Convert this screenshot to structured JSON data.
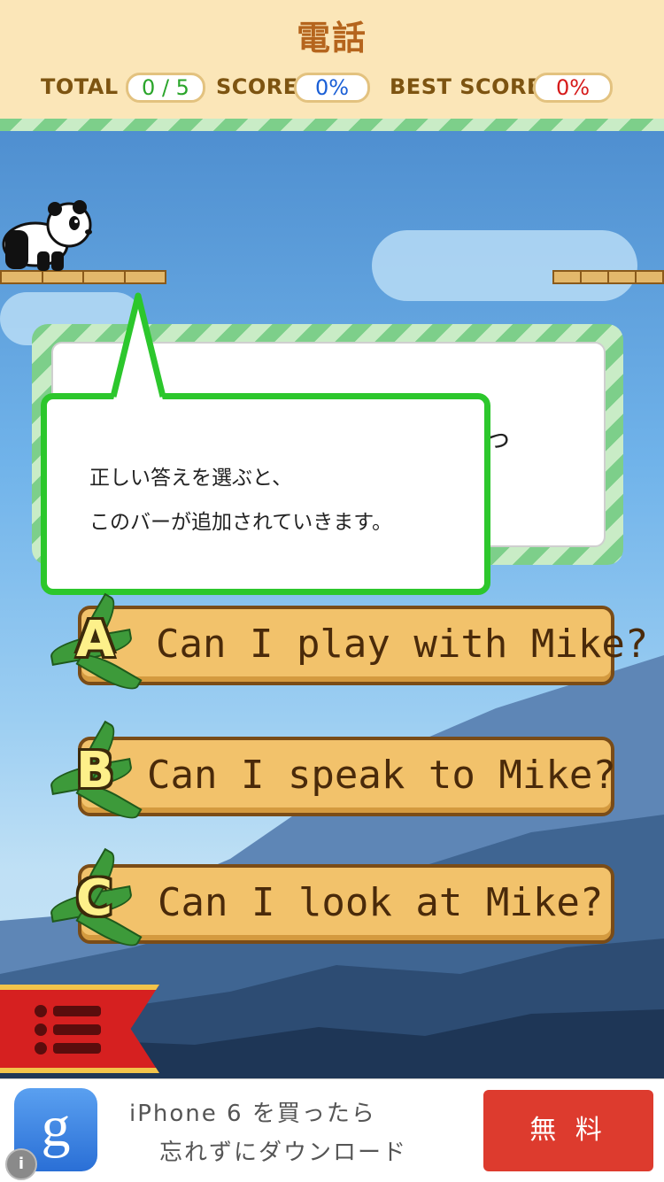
{
  "header": {
    "title": "電話",
    "total_label": "TOTAL",
    "total_value": "0 / 5",
    "score_label": "SCORE",
    "score_value": "0%",
    "best_label": "BEST SCORE",
    "best_value": "0%"
  },
  "tutorial": {
    "line1": "正しい答えを選ぶと、",
    "line2": "このバーが追加されていきます。"
  },
  "question": {
    "partial_glyph": "っ"
  },
  "answers": [
    {
      "letter": "A",
      "text": "Can I play with Mike?"
    },
    {
      "letter": "B",
      "text": "Can I speak to Mike?"
    },
    {
      "letter": "C",
      "text": "Can I look at Mike?"
    }
  ],
  "ad": {
    "line1": "iPhone 6 を買ったら",
    "line2": "忘れずにダウンロード",
    "button": "無 料",
    "logo_letter": "g",
    "info_glyph": "i"
  },
  "colors": {
    "header_bg": "#fbe6b8",
    "title": "#b5651d",
    "total_value": "#2aa52a",
    "score_value": "#1a5fd6",
    "best_value": "#d61a1a",
    "bubble_border": "#2cc72c",
    "ad_button": "#dd3b2e"
  }
}
